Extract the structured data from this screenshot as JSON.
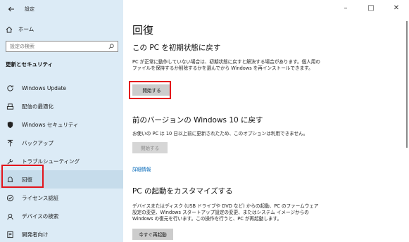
{
  "window": {
    "title": "設定",
    "minimize": "–",
    "maximize": "□",
    "close": "✕"
  },
  "sidebar": {
    "home": "ホーム",
    "search_placeholder": "設定の検索",
    "section": "更新とセキュリティ",
    "items": [
      {
        "label": "Windows Update",
        "icon": "sync-icon"
      },
      {
        "label": "配信の最適化",
        "icon": "delivery-optimization-icon"
      },
      {
        "label": "Windows セキュリティ",
        "icon": "shield-icon"
      },
      {
        "label": "バックアップ",
        "icon": "backup-icon"
      },
      {
        "label": "トラブルシューティング",
        "icon": "wrench-icon"
      },
      {
        "label": "回復",
        "icon": "recovery-icon",
        "active": true
      },
      {
        "label": "ライセンス認証",
        "icon": "activation-icon"
      },
      {
        "label": "デバイスの検索",
        "icon": "find-device-icon"
      },
      {
        "label": "開発者向け",
        "icon": "developer-icon"
      }
    ]
  },
  "main": {
    "title": "回復",
    "reset": {
      "heading": "この PC を初期状態に戻す",
      "desc": "PC が正常に動作していない場合は、初期状態に戻すと解決する場合があります。個人用のファイルを保持するか削除するかを選んでから Windows を再インストールできます。",
      "button": "開始する"
    },
    "previous": {
      "heading": "前のバージョンの Windows 10 に戻す",
      "desc": "お使いの PC は 10 日以上前に更新されたため、このオプションは利用できません。",
      "button": "開始する",
      "link": "詳細情報"
    },
    "startup": {
      "heading": "PC の起動をカスタマイズする",
      "desc": "デバイスまたはディスク (USB ドライブや DVD など) からの起動、PC のファームウェア設定の変更、Windows スタートアップ設定の変更、またはシステム イメージからの Windows の復元を行います。この操作を行うと、PC が再起動します。",
      "button": "今すぐ再起動"
    }
  },
  "colors": {
    "sidebar_bg": "#dcebf6",
    "highlight": "#e3141b",
    "link": "#0067b8"
  }
}
